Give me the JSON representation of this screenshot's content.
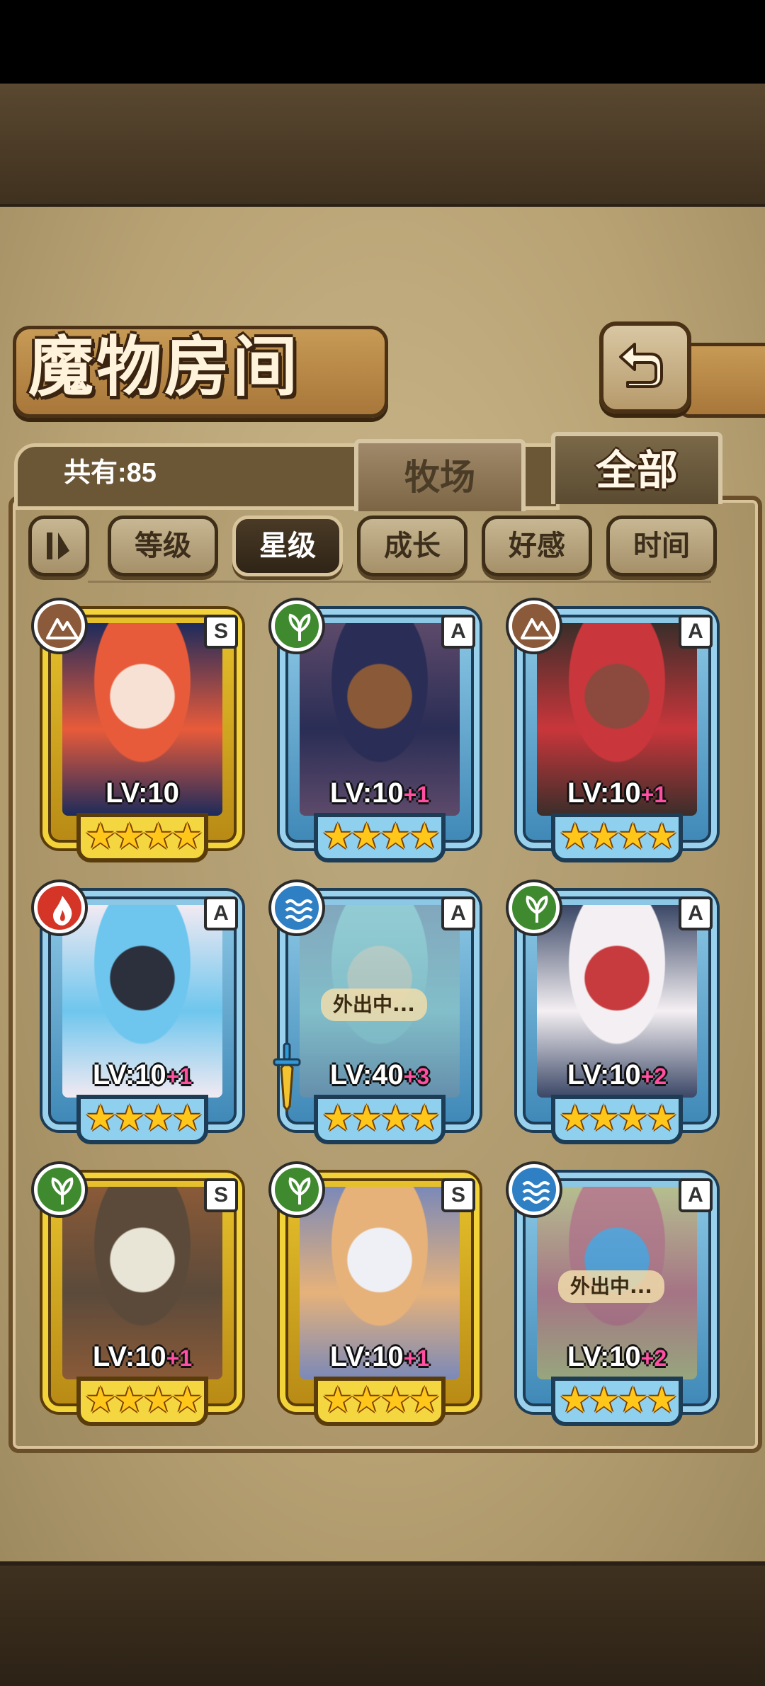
{
  "screen": {
    "title": "魔物房间",
    "count_label": "共有:85",
    "tabs": [
      {
        "label": "牧场",
        "active": false
      },
      {
        "label": "全部",
        "active": true
      }
    ]
  },
  "sort": {
    "buttons": [
      {
        "label": "等级",
        "active": false
      },
      {
        "label": "星级",
        "active": true
      },
      {
        "label": "成长",
        "active": false
      },
      {
        "label": "好感",
        "active": false
      },
      {
        "label": "时间",
        "active": false
      }
    ]
  },
  "monsters": [
    {
      "level": "LV:10",
      "bonus": "",
      "rank": "S",
      "tier": "gold",
      "element": "earth",
      "element_color": "#8a5a3b",
      "stars": "★★★★",
      "status": "",
      "equip": false,
      "palette": [
        "#e85b3a",
        "#f7e1d4",
        "#1d2b5c"
      ]
    },
    {
      "level": "LV:10",
      "bonus": "+1",
      "rank": "A",
      "tier": "blue",
      "element": "leaf",
      "element_color": "#3f8a2e",
      "stars": "★★★★",
      "status": "",
      "equip": false,
      "palette": [
        "#2a2d55",
        "#8a5a38",
        "#5d4a6a"
      ]
    },
    {
      "level": "LV:10",
      "bonus": "+1",
      "rank": "A",
      "tier": "blue",
      "element": "earth",
      "element_color": "#8a5a3b",
      "stars": "★★★★",
      "status": "",
      "equip": false,
      "palette": [
        "#c9363b",
        "#8b4a3d",
        "#3a2e2a"
      ]
    },
    {
      "level": "LV:10",
      "bonus": "+1",
      "rank": "A",
      "tier": "blue",
      "element": "fire",
      "element_color": "#d43527",
      "stars": "★★★★",
      "status": "",
      "equip": false,
      "palette": [
        "#6ec6ee",
        "#2c2f3c",
        "#f2eaf2"
      ]
    },
    {
      "level": "LV:40",
      "bonus": "+3",
      "rank": "A",
      "tier": "blue",
      "element": "water",
      "element_color": "#2e7fc4",
      "stars": "★★★★",
      "status": "外出中...",
      "equip": true,
      "palette": [
        "#9ad1c6",
        "#e0d8b4",
        "#7c8e9e"
      ]
    },
    {
      "level": "LV:10",
      "bonus": "+2",
      "rank": "A",
      "tier": "blue",
      "element": "leaf",
      "element_color": "#3f8a2e",
      "stars": "★★★★",
      "status": "",
      "equip": false,
      "palette": [
        "#f4eff2",
        "#c73b3f",
        "#3a4766"
      ]
    },
    {
      "level": "LV:10",
      "bonus": "+1",
      "rank": "S",
      "tier": "gold",
      "element": "leaf",
      "element_color": "#3f8a2e",
      "stars": "★★★★",
      "status": "",
      "equip": false,
      "palette": [
        "#5b4a3a",
        "#e8e4d6",
        "#8a5a38"
      ]
    },
    {
      "level": "LV:10",
      "bonus": "+1",
      "rank": "S",
      "tier": "gold",
      "element": "leaf",
      "element_color": "#3f8a2e",
      "stars": "★★★★",
      "status": "",
      "equip": false,
      "palette": [
        "#e6b27a",
        "#eef0f6",
        "#7b89b8"
      ]
    },
    {
      "level": "LV:10",
      "bonus": "+2",
      "rank": "A",
      "tier": "blue",
      "element": "water",
      "element_color": "#2e7fc4",
      "stars": "★★★★",
      "status": "外出中...",
      "equip": false,
      "palette": [
        "#d94a4a",
        "#3b8fd1",
        "#d8b94a"
      ]
    }
  ]
}
